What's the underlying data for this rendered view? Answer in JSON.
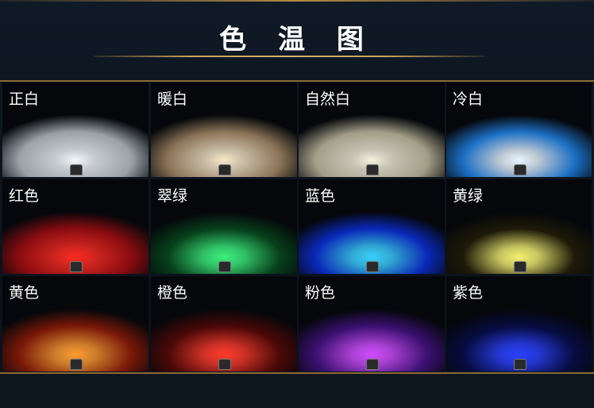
{
  "page": {
    "title": "色 温 图"
  },
  "tiles": [
    {
      "label": "正白",
      "color": "#f4f8fb",
      "edge": "#9aa2a8"
    },
    {
      "label": "暖白",
      "color": "#f8e6c8",
      "edge": "#8c7458"
    },
    {
      "label": "自然白",
      "color": "#f6f0dc",
      "edge": "#a39e88"
    },
    {
      "label": "冷白",
      "color": "#e8f4ff",
      "edge": "#1c6fc4"
    },
    {
      "label": "红色",
      "color": "#ff2a20",
      "edge": "#8a0c10"
    },
    {
      "label": "翠绿",
      "color": "#3cf07c",
      "edge": "#07401c"
    },
    {
      "label": "蓝色",
      "color": "#3ad0ff",
      "edge": "#0a28b8"
    },
    {
      "label": "黄绿",
      "color": "#f4f070",
      "edge": "#1e1a08"
    },
    {
      "label": "黄色",
      "color": "#ff9a30",
      "edge": "#7a1808"
    },
    {
      "label": "橙色",
      "color": "#ff3a2a",
      "edge": "#4a0808"
    },
    {
      "label": "粉色",
      "color": "#d04cff",
      "edge": "#3a1070"
    },
    {
      "label": "紫色",
      "color": "#2a40ff",
      "edge": "#060c40"
    }
  ]
}
